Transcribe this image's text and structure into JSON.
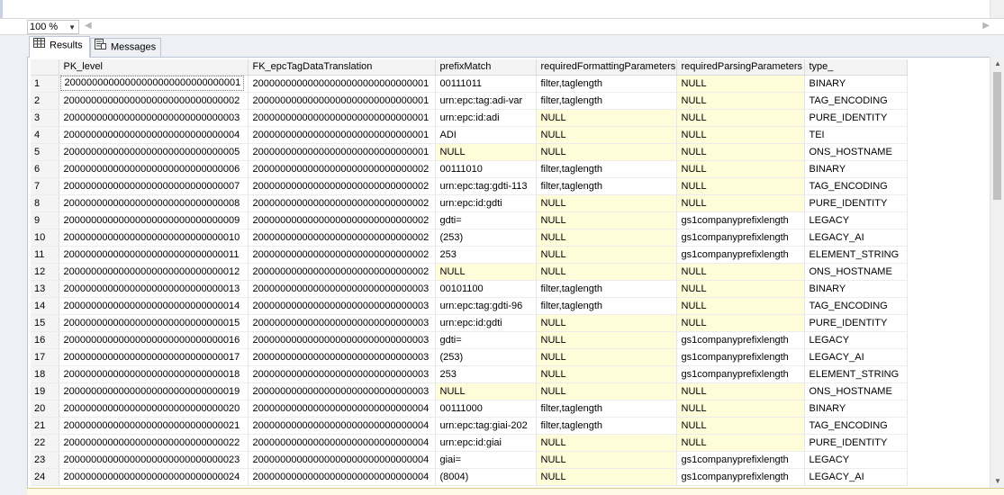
{
  "zoom": {
    "value": "100 %"
  },
  "tabs": [
    {
      "label": "Results",
      "icon": "grid-icon",
      "active": true
    },
    {
      "label": "Messages",
      "icon": "messages-icon",
      "active": false
    }
  ],
  "columns": [
    "PK_level",
    "FK_epcTagDataTranslation",
    "prefixMatch",
    "requiredFormattingParameters",
    "requiredParsingParameters",
    "type_"
  ],
  "rows": [
    [
      "1",
      "20000000000000000000000000000001",
      "20000000000000000000000000000001",
      "00111011",
      "filter,taglength",
      "NULL",
      "BINARY"
    ],
    [
      "2",
      "20000000000000000000000000000002",
      "20000000000000000000000000000001",
      "urn:epc:tag:adi-var",
      "filter,taglength",
      "NULL",
      "TAG_ENCODING"
    ],
    [
      "3",
      "20000000000000000000000000000003",
      "20000000000000000000000000000001",
      "urn:epc:id:adi",
      "NULL",
      "NULL",
      "PURE_IDENTITY"
    ],
    [
      "4",
      "20000000000000000000000000000004",
      "20000000000000000000000000000001",
      "ADI",
      "NULL",
      "NULL",
      "TEI"
    ],
    [
      "5",
      "20000000000000000000000000000005",
      "20000000000000000000000000000001",
      "NULL",
      "NULL",
      "NULL",
      "ONS_HOSTNAME"
    ],
    [
      "6",
      "20000000000000000000000000000006",
      "20000000000000000000000000000002",
      "00111010",
      "filter,taglength",
      "NULL",
      "BINARY"
    ],
    [
      "7",
      "20000000000000000000000000000007",
      "20000000000000000000000000000002",
      "urn:epc:tag:gdti-113",
      "filter,taglength",
      "NULL",
      "TAG_ENCODING"
    ],
    [
      "8",
      "20000000000000000000000000000008",
      "20000000000000000000000000000002",
      "urn:epc:id:gdti",
      "NULL",
      "NULL",
      "PURE_IDENTITY"
    ],
    [
      "9",
      "20000000000000000000000000000009",
      "20000000000000000000000000000002",
      "gdti=",
      "NULL",
      "gs1companyprefixlength",
      "LEGACY"
    ],
    [
      "10",
      "20000000000000000000000000000010",
      "20000000000000000000000000000002",
      "(253)",
      "NULL",
      "gs1companyprefixlength",
      "LEGACY_AI"
    ],
    [
      "11",
      "20000000000000000000000000000011",
      "20000000000000000000000000000002",
      "253",
      "NULL",
      "gs1companyprefixlength",
      "ELEMENT_STRING"
    ],
    [
      "12",
      "20000000000000000000000000000012",
      "20000000000000000000000000000002",
      "NULL",
      "NULL",
      "NULL",
      "ONS_HOSTNAME"
    ],
    [
      "13",
      "20000000000000000000000000000013",
      "20000000000000000000000000000003",
      "00101100",
      "filter,taglength",
      "NULL",
      "BINARY"
    ],
    [
      "14",
      "20000000000000000000000000000014",
      "20000000000000000000000000000003",
      "urn:epc:tag:gdti-96",
      "filter,taglength",
      "NULL",
      "TAG_ENCODING"
    ],
    [
      "15",
      "20000000000000000000000000000015",
      "20000000000000000000000000000003",
      "urn:epc:id:gdti",
      "NULL",
      "NULL",
      "PURE_IDENTITY"
    ],
    [
      "16",
      "20000000000000000000000000000016",
      "20000000000000000000000000000003",
      "gdti=",
      "NULL",
      "gs1companyprefixlength",
      "LEGACY"
    ],
    [
      "17",
      "20000000000000000000000000000017",
      "20000000000000000000000000000003",
      "(253)",
      "NULL",
      "gs1companyprefixlength",
      "LEGACY_AI"
    ],
    [
      "18",
      "20000000000000000000000000000018",
      "20000000000000000000000000000003",
      "253",
      "NULL",
      "gs1companyprefixlength",
      "ELEMENT_STRING"
    ],
    [
      "19",
      "20000000000000000000000000000019",
      "20000000000000000000000000000003",
      "NULL",
      "NULL",
      "NULL",
      "ONS_HOSTNAME"
    ],
    [
      "20",
      "20000000000000000000000000000020",
      "20000000000000000000000000000004",
      "00111000",
      "filter,taglength",
      "NULL",
      "BINARY"
    ],
    [
      "21",
      "20000000000000000000000000000021",
      "20000000000000000000000000000004",
      "urn:epc:tag:giai-202",
      "filter,taglength",
      "NULL",
      "TAG_ENCODING"
    ],
    [
      "22",
      "20000000000000000000000000000022",
      "20000000000000000000000000000004",
      "urn:epc:id:giai",
      "NULL",
      "NULL",
      "PURE_IDENTITY"
    ],
    [
      "23",
      "20000000000000000000000000000023",
      "20000000000000000000000000000004",
      "giai=",
      "NULL",
      "gs1companyprefixlength",
      "LEGACY"
    ],
    [
      "24",
      "20000000000000000000000000000024",
      "20000000000000000000000000000004",
      "(8004)",
      "NULL",
      "gs1companyprefixlength",
      "LEGACY_AI"
    ]
  ],
  "colors": {
    "null_cell": "#fffdd9",
    "header_bg": "#f4f4f4",
    "panel_bg": "#eef0f5"
  }
}
